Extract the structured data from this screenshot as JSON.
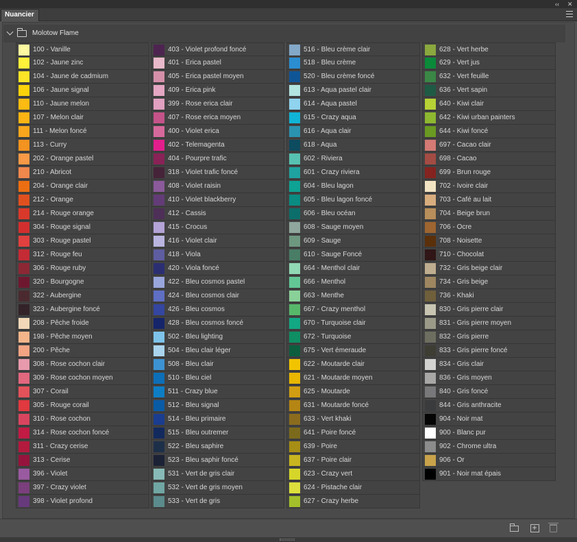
{
  "window": {
    "tab_title": "Nuancier",
    "collapse_glyph": "‹‹",
    "close_glyph": "✕"
  },
  "group": {
    "name": "Molotow Flame"
  },
  "icons": {
    "collapse": "double-chevron-icon",
    "close": "close-icon",
    "panel_menu": "hamburger-menu-icon",
    "disclosure": "chevron-down-icon",
    "group_folder": "folder-icon",
    "new_group": "folder-icon",
    "new_swatch": "new-swatch-icon",
    "delete": "trash-icon"
  },
  "columns": [
    [
      {
        "label": "100 - Vanille",
        "color": "#fdf9a0"
      },
      {
        "label": "102 - Jaune zinc",
        "color": "#fff23a"
      },
      {
        "label": "104 - Jaune de cadmium",
        "color": "#fde427"
      },
      {
        "label": "106 - Jaune signal",
        "color": "#fcd20a"
      },
      {
        "label": "110 - Jaune melon",
        "color": "#fbbb12"
      },
      {
        "label": "107 - Melon clair",
        "color": "#fbb414"
      },
      {
        "label": "111 - Melon foncé",
        "color": "#f8a71c"
      },
      {
        "label": "113 - Curry",
        "color": "#f39320"
      },
      {
        "label": "202 - Orange pastel",
        "color": "#f79946"
      },
      {
        "label": "210 - Abricot",
        "color": "#f0874d"
      },
      {
        "label": "204 - Orange clair",
        "color": "#ec6e12"
      },
      {
        "label": "212 - Orange",
        "color": "#e0501f"
      },
      {
        "label": "214 - Rouge orange",
        "color": "#d9392a"
      },
      {
        "label": "304 - Rouge signal",
        "color": "#d32f2f"
      },
      {
        "label": "303 - Rouge pastel",
        "color": "#e0403e"
      },
      {
        "label": "312 - Rouge feu",
        "color": "#c42b35"
      },
      {
        "label": "306 - Rouge ruby",
        "color": "#8c2734"
      },
      {
        "label": "320 - Bourgogne",
        "color": "#6e1830"
      },
      {
        "label": "322 - Aubergine",
        "color": "#4a2a2f"
      },
      {
        "label": "323 - Aubergine foncé",
        "color": "#332328"
      },
      {
        "label": "208 - Pêche froide",
        "color": "#f2d8b8"
      },
      {
        "label": "198 - Pêche moyen",
        "color": "#f4b58a"
      },
      {
        "label": "200 - Pêche",
        "color": "#f2a483"
      },
      {
        "label": "308 - Rose cochon clair",
        "color": "#e79aac"
      },
      {
        "label": "309 - Rose cochon moyen",
        "color": "#e1687f"
      },
      {
        "label": "307 - Corail",
        "color": "#e2525a"
      },
      {
        "label": "305 - Rouge corail",
        "color": "#e0393f"
      },
      {
        "label": "310 - Rose cochon",
        "color": "#d9455f"
      },
      {
        "label": "314 - Rose cochon foncé",
        "color": "#c21b44"
      },
      {
        "label": "311 - Crazy cerise",
        "color": "#b31a3d"
      },
      {
        "label": "313 - Cerise",
        "color": "#95133c"
      },
      {
        "label": "396 - Violet",
        "color": "#9a5aa0"
      },
      {
        "label": "397 - Crazy violet",
        "color": "#7a3f7c"
      },
      {
        "label": "398 - Violet profond",
        "color": "#673a7c"
      }
    ],
    [
      {
        "label": "403 -  Violet profond foncé",
        "color": "#4d2450"
      },
      {
        "label": "401 - Erica pastel",
        "color": "#e8b9ca"
      },
      {
        "label": "405 - Erica pastel moyen",
        "color": "#d58fa9"
      },
      {
        "label": "409 - Erica pink",
        "color": "#e4a6c2"
      },
      {
        "label": "399 - Rose erica clair",
        "color": "#e0a0bf"
      },
      {
        "label": "407 - Rose erica moyen",
        "color": "#c45389"
      },
      {
        "label": "400 - Violet erica",
        "color": "#d6699c"
      },
      {
        "label": "402 - Telemagenta",
        "color": "#e21e8c"
      },
      {
        "label": "404 - Pourpre trafic",
        "color": "#892256"
      },
      {
        "label": "318 - Violet trafic foncé",
        "color": "#452338"
      },
      {
        "label": "408 - Violet raisin",
        "color": "#8b5a9b"
      },
      {
        "label": "410 - Violet blackberry",
        "color": "#633c77"
      },
      {
        "label": "412 - Cassis",
        "color": "#4d2f57"
      },
      {
        "label": "415 - Crocus",
        "color": "#b3a3d6"
      },
      {
        "label": "416 - Violet clair",
        "color": "#b9b5e0"
      },
      {
        "label": "418 - Viola",
        "color": "#5e5da0"
      },
      {
        "label": "420 - Viola foncé",
        "color": "#2b2f72"
      },
      {
        "label": "422 - Bleu cosmos pastel",
        "color": "#99a6dc"
      },
      {
        "label": "424 - Bleu cosmos clair",
        "color": "#5f6fc3"
      },
      {
        "label": "426 - Bleu cosmos",
        "color": "#3446a0"
      },
      {
        "label": "428 - Bleu cosmos foncé",
        "color": "#16246a"
      },
      {
        "label": "502 - Bleu lighting",
        "color": "#7dc3ea"
      },
      {
        "label": "504 - Bleu clair léger",
        "color": "#aad4ee"
      },
      {
        "label": "508 - Bleu clair",
        "color": "#3d92d2"
      },
      {
        "label": "510 - Bleu ciel",
        "color": "#0d6fb7"
      },
      {
        "label": "511 - Crazy blue",
        "color": "#0e7ec4"
      },
      {
        "label": "512 - Bleu signal",
        "color": "#0a5ba6"
      },
      {
        "label": "514 - Bleu primaire",
        "color": "#1b3d8f"
      },
      {
        "label": "515 - Bleu outremer",
        "color": "#12295e"
      },
      {
        "label": "522 - Bleu saphire",
        "color": "#1d3049"
      },
      {
        "label": "523 - Bleu saphir foncé",
        "color": "#1c2236"
      },
      {
        "label": "531 -  Vert de gris clair",
        "color": "#88bbb7"
      },
      {
        "label": "532 - Vert de gris moyen",
        "color": "#70a6a3"
      },
      {
        "label": "533 - Vert de gris",
        "color": "#5b8b8c"
      }
    ],
    [
      {
        "label": "516 - Bleu crème clair",
        "color": "#83a8c8"
      },
      {
        "label": "518 - Bleu crème",
        "color": "#2b8ed0"
      },
      {
        "label": "520 - Bleu crème foncé",
        "color": "#0f5596"
      },
      {
        "label": "613 - Aqua pastel clair",
        "color": "#b2e4e0"
      },
      {
        "label": "614 - Aqua pastel",
        "color": "#8fd3ee"
      },
      {
        "label": "615 - Crazy aqua",
        "color": "#10b4d6"
      },
      {
        "label": "616 - Aqua clair",
        "color": "#2a93b0"
      },
      {
        "label": "618 - Aqua",
        "color": "#0d4b5f"
      },
      {
        "label": "602 - Riviera",
        "color": "#57c2b2"
      },
      {
        "label": "601 - Crazy riviera",
        "color": "#1fa3a0"
      },
      {
        "label": "604 - Bleu lagon",
        "color": "#0ea394"
      },
      {
        "label": "605 - Bleu lagon foncé",
        "color": "#0a8c82"
      },
      {
        "label": "606 - Bleu océan",
        "color": "#0c6e6a"
      },
      {
        "label": "608 - Sauge moyen",
        "color": "#8fa79c"
      },
      {
        "label": "609 - Sauge",
        "color": "#6e9780"
      },
      {
        "label": "610 - Sauge Foncé",
        "color": "#497d66"
      },
      {
        "label": "664 - Menthol clair",
        "color": "#91d8b4"
      },
      {
        "label": "666 - Menthol",
        "color": "#62c694"
      },
      {
        "label": "663 - Menthe",
        "color": "#8ad199"
      },
      {
        "label": "667 - Crazy menthol",
        "color": "#57b86a"
      },
      {
        "label": "670 - Turquoise clair",
        "color": "#12a884"
      },
      {
        "label": "672 - Turquoise",
        "color": "#0f8f63"
      },
      {
        "label": "675 - Vert émeraude",
        "color": "#0c5e3e"
      },
      {
        "label": "622 - Moutarde clair",
        "color": "#f2c400"
      },
      {
        "label": "621 - Moutarde moyen",
        "color": "#e9b600"
      },
      {
        "label": "625 - Moutarde",
        "color": "#d19d12"
      },
      {
        "label": "631 - Moutarde foncé",
        "color": "#b58614"
      },
      {
        "label": "633 - Vert khaki",
        "color": "#8b6c1e"
      },
      {
        "label": "641 - Poire foncé",
        "color": "#7c6a1c"
      },
      {
        "label": "639 - Poire",
        "color": "#a78e15"
      },
      {
        "label": "637 - Poire clair",
        "color": "#c9b51f"
      },
      {
        "label": "623 - Crazy vert",
        "color": "#d6d62a"
      },
      {
        "label": "624 - Pistache clair",
        "color": "#dcdf3c"
      },
      {
        "label": "627 - Crazy herbe",
        "color": "#a3c02a"
      }
    ],
    [
      {
        "label": "628 - Vert herbe",
        "color": "#8aa83e"
      },
      {
        "label": "629 - Vert jus",
        "color": "#0b8a3a"
      },
      {
        "label": "632 - Vert feuille",
        "color": "#3a8746"
      },
      {
        "label": "636 - Vert sapin",
        "color": "#1f5a45"
      },
      {
        "label": "640 - Kiwi clair",
        "color": "#b6d235"
      },
      {
        "label": "642 - Kiwi urban painters",
        "color": "#8db830"
      },
      {
        "label": "644 - Kiwi foncé",
        "color": "#6a9a22"
      },
      {
        "label": "697 - Cacao clair",
        "color": "#d57a74"
      },
      {
        "label": "698 - Cacao",
        "color": "#a34c44"
      },
      {
        "label": "699 - Brun rouge",
        "color": "#84231f"
      },
      {
        "label": "702 - Ivoire clair",
        "color": "#f2e3c3"
      },
      {
        "label": "703 - Café au lait",
        "color": "#d8ad7e"
      },
      {
        "label": "704 - Beige brun",
        "color": "#b88e5a"
      },
      {
        "label": "706 - Ocre",
        "color": "#9e6531"
      },
      {
        "label": "708 - Noisette",
        "color": "#5a300b"
      },
      {
        "label": "710 - Chocolat",
        "color": "#301616"
      },
      {
        "label": "732 - Gris beige clair",
        "color": "#bfad8f"
      },
      {
        "label": "734 - Gris beige",
        "color": "#9e8660"
      },
      {
        "label": "736 - Khaki",
        "color": "#705f3b"
      },
      {
        "label": "830 - Gris pierre clair",
        "color": "#c8c6b2"
      },
      {
        "label": "831 - Gris pierre moyen",
        "color": "#9b9a88"
      },
      {
        "label": "832 - Gris pierre",
        "color": "#6e6e60"
      },
      {
        "label": "833 - Gris pierre foncé",
        "color": "#3e3d34"
      },
      {
        "label": "834 - Gris clair",
        "color": "#d3d3d1"
      },
      {
        "label": "836 - Gris moyen",
        "color": "#a8a7a6"
      },
      {
        "label": "840 - Gris foncé",
        "color": "#78787a"
      },
      {
        "label": "844 - Gris anthracite",
        "color": "#3a3b3d"
      },
      {
        "label": "904 - Noir mat",
        "color": "#050505"
      },
      {
        "label": "900 - Blanc pur",
        "color": "#ffffff"
      },
      {
        "label": "902 - Chrome ultra",
        "color": "#8c8c8c"
      },
      {
        "label": "906 - Or",
        "color": "#c9a24a"
      },
      {
        "label": "901 - Noir mat épais",
        "color": "#000000"
      }
    ]
  ]
}
